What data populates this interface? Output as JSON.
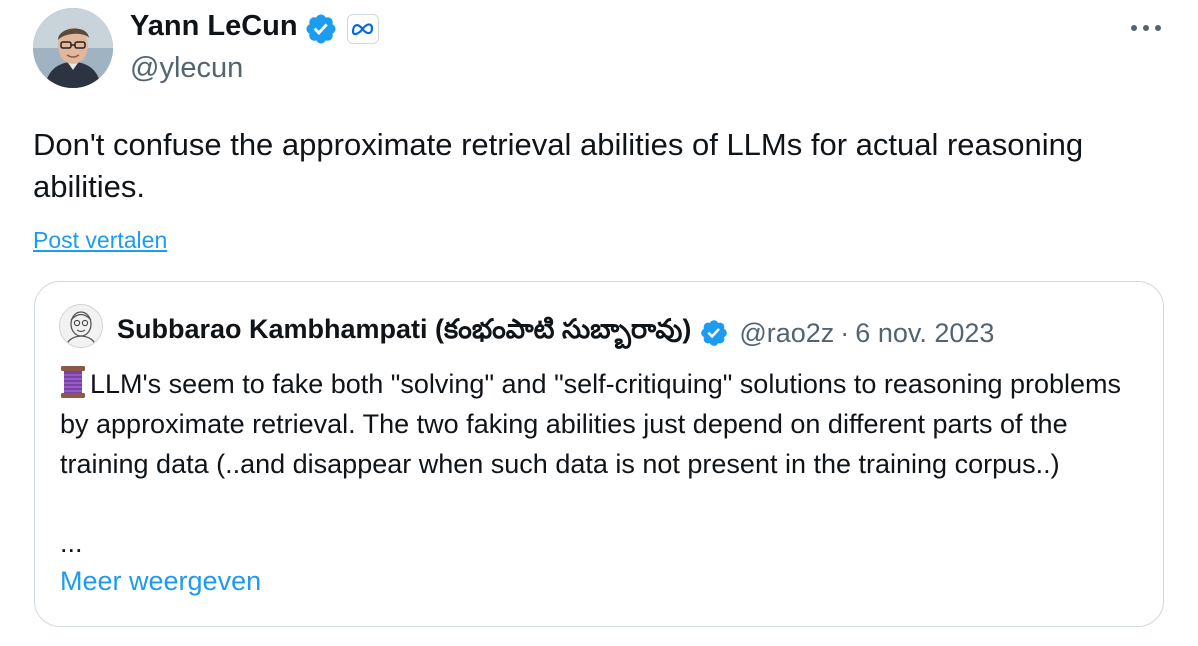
{
  "author": {
    "name": "Yann LeCun",
    "handle": "@ylecun",
    "verified": true,
    "affiliate_icon": "meta-logo-icon"
  },
  "tweet": {
    "text": "Don't confuse the approximate retrieval abilities of LLMs for actual reasoning abilities.",
    "translate_label": "Post vertalen"
  },
  "quoted": {
    "name": "Subbarao Kambhampati (కంభంపాటి సుబ్బారావు)",
    "handle": "@rao2z",
    "separator": "·",
    "date": "6 nov. 2023",
    "lead_icon": "thread-spool-icon",
    "text": "LLM's seem to fake both \"solving\" and \"self-critiquing\" solutions to reasoning problems by approximate retrieval. The two faking abilities just depend on different parts of the training data (..and disappear when such data is not present in the training corpus..)",
    "ellipsis": "...",
    "show_more_label": "Meer weergeven"
  },
  "colors": {
    "text_primary": "#0f1419",
    "text_secondary": "#536471",
    "link_blue": "#1d9bf0",
    "border": "#cfd9de"
  }
}
